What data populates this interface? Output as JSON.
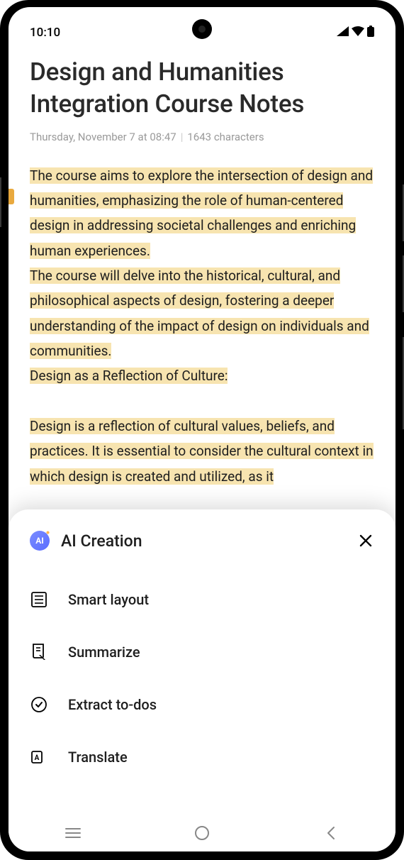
{
  "status": {
    "time": "10:10"
  },
  "note": {
    "title": "Design and Humanities Integration Course Notes",
    "meta_date": "Thursday, November 7 at 08:47",
    "meta_chars": "1643 characters",
    "body_p1": "The course aims to explore the intersection of design and humanities, emphasizing the role of human-centered design in addressing societal challenges and enriching human experiences.",
    "body_p2": "The course will delve into the historical, cultural, and philosophical aspects of design, fostering a deeper understanding of the impact of design on individuals and communities.",
    "body_p3": "Design as a Reflection of Culture:",
    "body_p4": "Design is a reflection of cultural values, beliefs, and practices. It is essential to consider the cultural context in which design is created and utilized, as it"
  },
  "panel": {
    "title": "AI Creation",
    "badge_text": "AI",
    "items": {
      "smart_layout": "Smart layout",
      "summarize": "Summarize",
      "extract_todos": "Extract to-dos",
      "translate": "Translate"
    }
  }
}
